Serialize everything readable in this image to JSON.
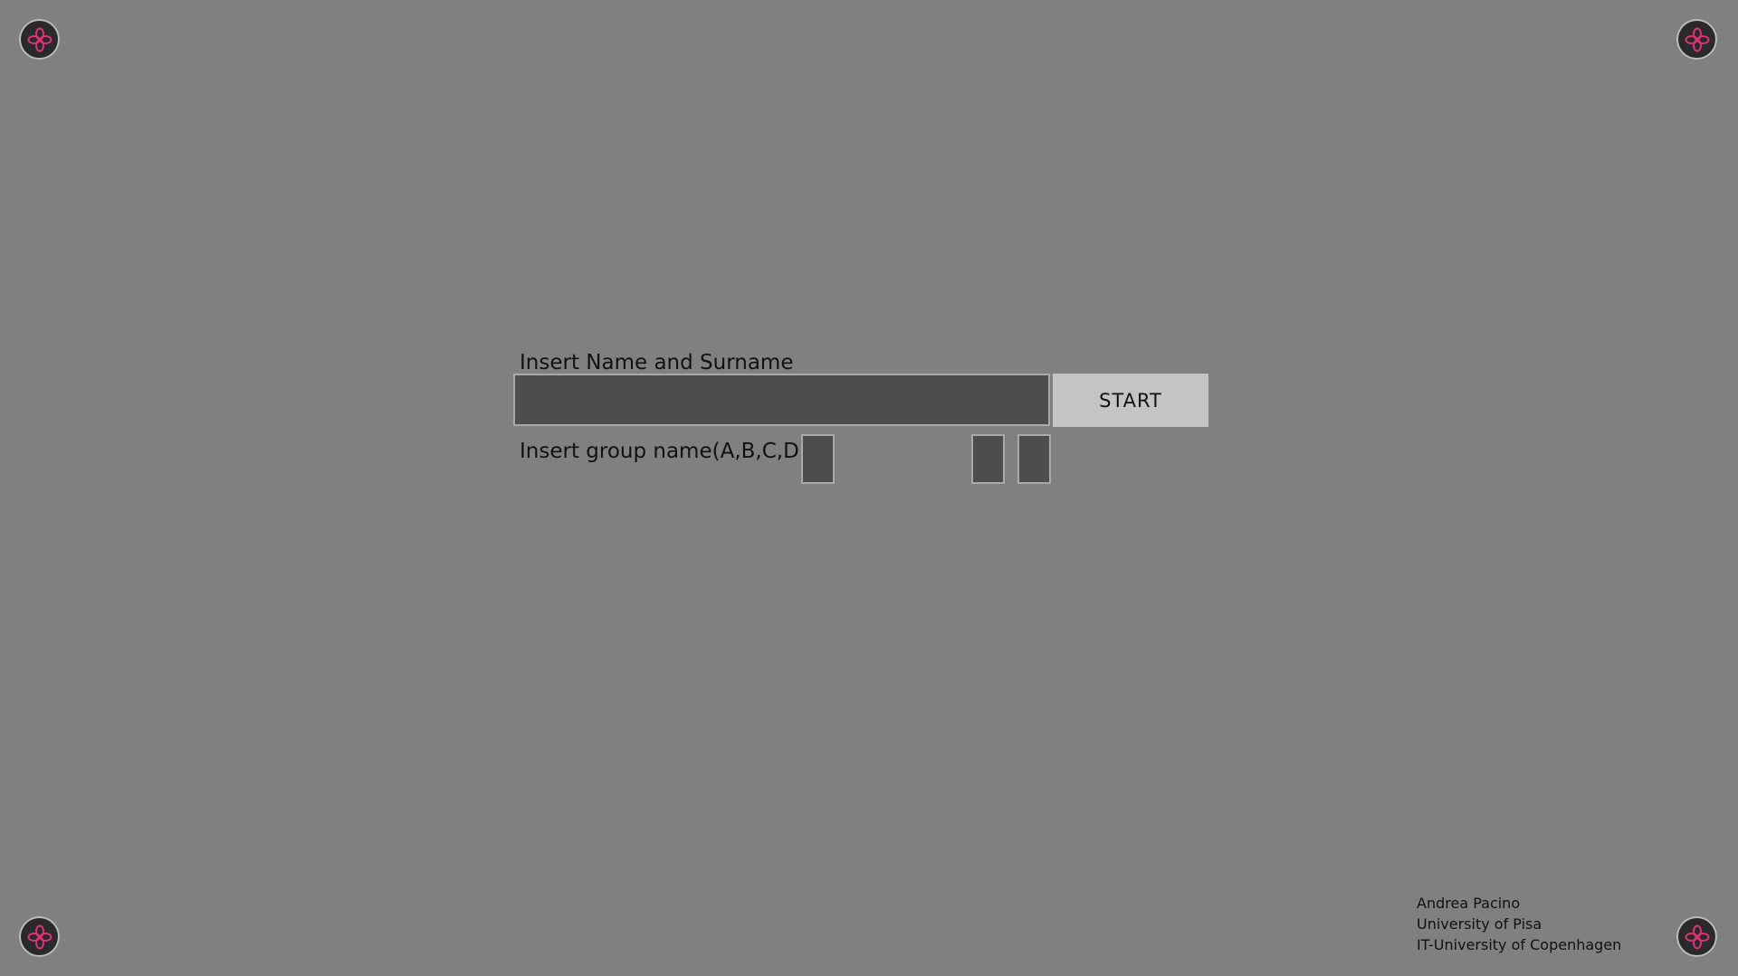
{
  "markers": {
    "icon": "pink-quatrefoil-icon",
    "fill_color": "#2a2a2a",
    "icon_color": "#e0307a"
  },
  "form": {
    "name_label": "Insert Name and Surname",
    "name_value": "",
    "start_label": "START",
    "group_label": "Insert group name(A,B,C,D)",
    "group_values": [
      "",
      "",
      ""
    ]
  },
  "credits": {
    "line1": "Andrea Pacino",
    "line2": "University of Pisa",
    "line3": "IT-University of Copenhagen"
  }
}
